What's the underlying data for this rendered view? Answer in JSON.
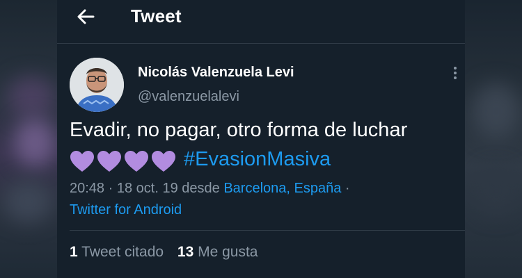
{
  "header": {
    "title": "Tweet",
    "back_icon": "back-arrow-icon"
  },
  "author": {
    "name": "Nicolás Valenzuela Levi",
    "handle": "@valenzuelalevi",
    "avatar_icon": "avatar"
  },
  "tweet": {
    "text": "Evadir, no pagar, otro forma de luchar",
    "hearts_count": 4,
    "heart_color": "#b28ce0",
    "hashtag": "#EvasionMasiva"
  },
  "meta": {
    "time": "20:48",
    "date": "18 oct. 19",
    "from_label": "desde",
    "location": "Barcelona, España",
    "separator": "·",
    "client": "Twitter for Android"
  },
  "stats": {
    "quotes_count": "1",
    "quotes_label": "Tweet citado",
    "likes_count": "13",
    "likes_label": "Me gusta"
  },
  "colors": {
    "background": "#15202b",
    "accent": "#1d9bf0",
    "muted": "#8b98a5"
  }
}
